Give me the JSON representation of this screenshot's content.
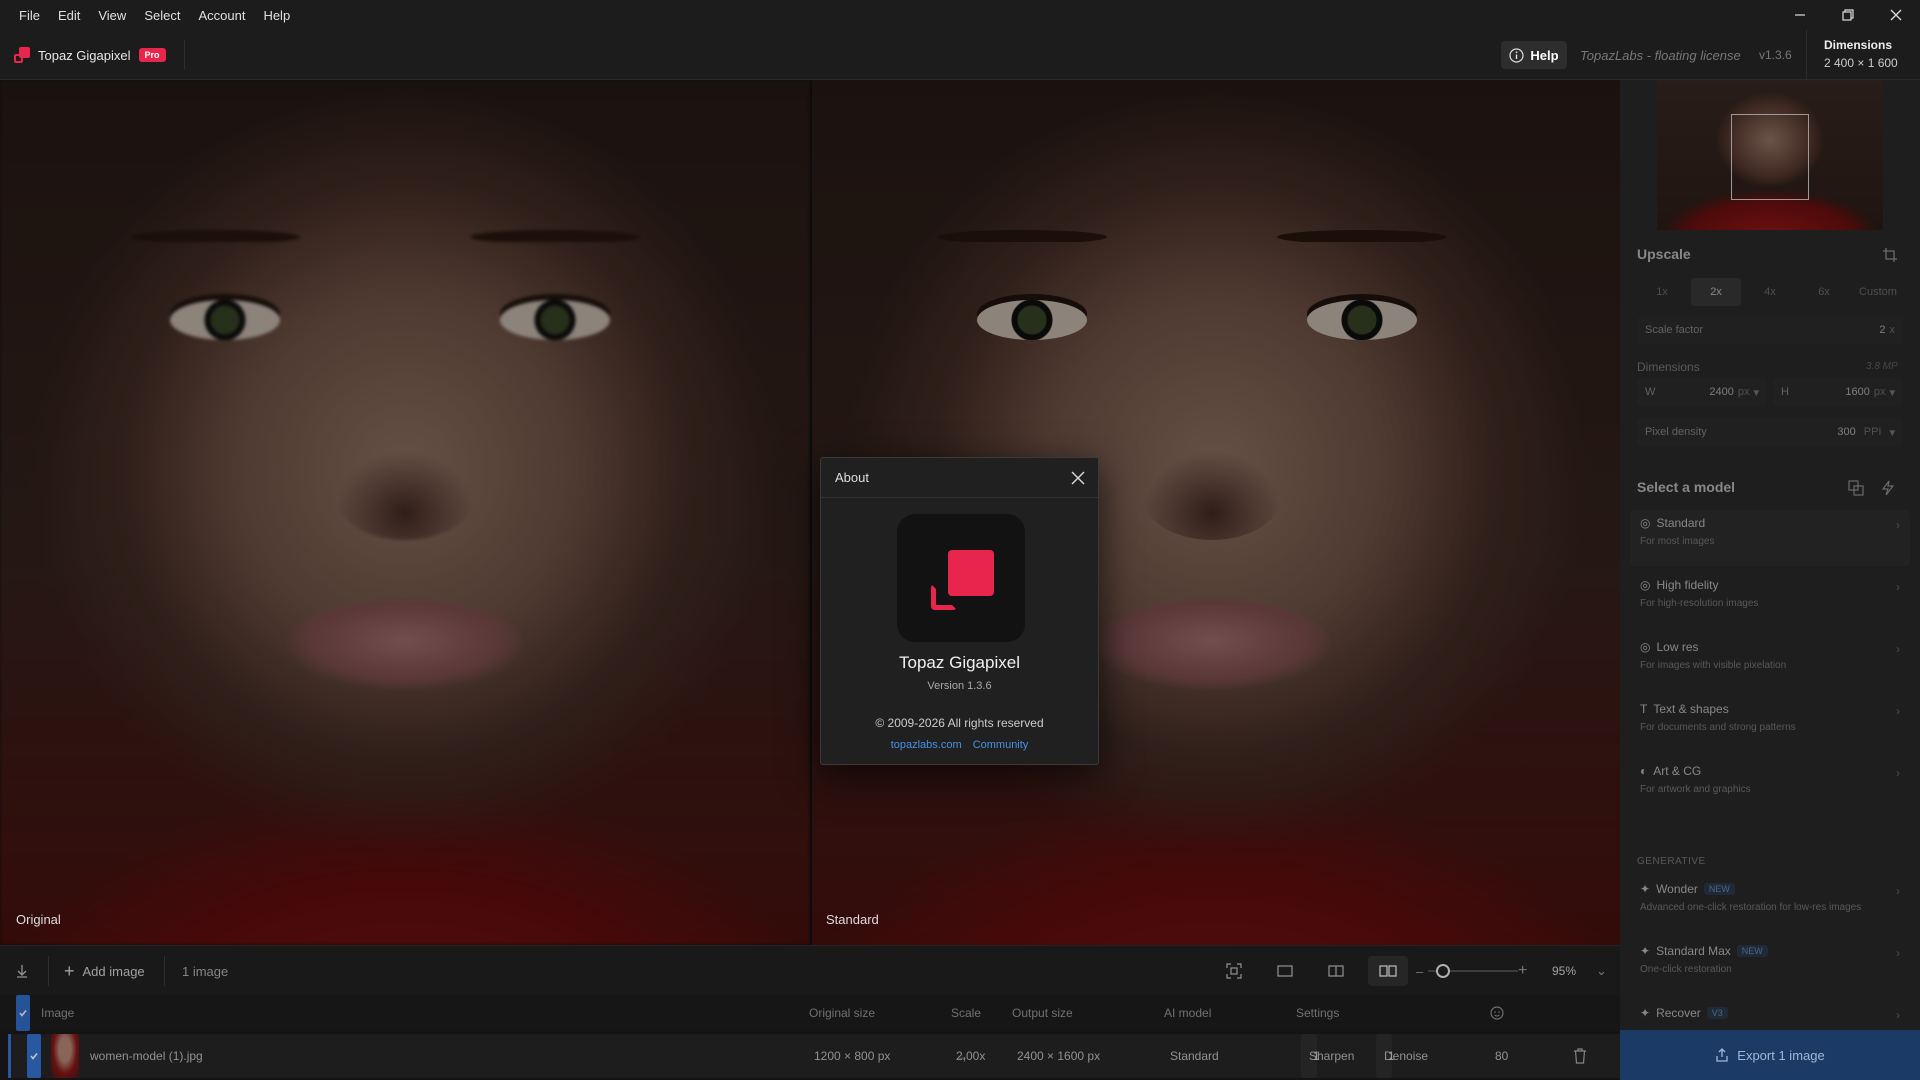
{
  "menu": [
    "File",
    "Edit",
    "View",
    "Select",
    "Account",
    "Help"
  ],
  "app": {
    "title": "Topaz Gigapixel",
    "badge": "Pro",
    "help_label": "Help",
    "license": "TopazLabs - floating license",
    "version": "v1.3.6",
    "dimensions_label": "Dimensions",
    "dimensions_value": "2 400 × 1 600"
  },
  "viewer": {
    "left_label": "Original",
    "right_label": "Standard"
  },
  "upscale": {
    "title": "Upscale",
    "tabs": [
      "1x",
      "2x",
      "4x",
      "6x",
      "Custom"
    ],
    "active_tab": "2x",
    "scale_factor_label": "Scale factor",
    "scale_factor_value": "2",
    "scale_factor_unit": "x",
    "dimensions_label": "Dimensions",
    "megapixels": "3.8 MP",
    "w_label": "W",
    "w_value": "2400",
    "h_label": "H",
    "h_value": "1600",
    "unit": "px",
    "density_label": "Pixel density",
    "density_value": "300",
    "density_unit": "PPI"
  },
  "models": {
    "title": "Select a model",
    "items": [
      {
        "name": "Standard",
        "desc": "For most images"
      },
      {
        "name": "High fidelity",
        "desc": "For high-resolution images"
      },
      {
        "name": "Low res",
        "desc": "For images with visible pixelation"
      },
      {
        "name": "Text & shapes",
        "desc": "For documents and strong patterns"
      },
      {
        "name": "Art & CG",
        "desc": "For artwork and graphics"
      }
    ],
    "generative_label": "GENERATIVE",
    "generative": [
      {
        "name": "Wonder",
        "badge": "NEW",
        "desc": "Advanced one-click restoration for low-res images"
      },
      {
        "name": "Standard Max",
        "badge": "NEW",
        "desc": "One-click restoration"
      },
      {
        "name": "Recover",
        "badge": "V3",
        "desc": ""
      }
    ]
  },
  "export_label": "Export 1 image",
  "toolbar": {
    "add_image": "Add image",
    "count": "1 image",
    "zoom": "95%"
  },
  "list": {
    "headers": {
      "image": "Image",
      "original_size": "Original size",
      "scale": "Scale",
      "output_size": "Output size",
      "ai_model": "AI model",
      "settings": "Settings"
    },
    "row": {
      "filename": "women-model (1).jpg",
      "original_size": "1200 × 800 px",
      "scale": "2,00x",
      "output_size": "2400 × 1600 px",
      "model": "Standard",
      "sharpen": "Sharpen",
      "sharpen_val": "1",
      "denoise": "Denoise",
      "denoise_val": "1",
      "face": "80"
    }
  },
  "about": {
    "title": "About",
    "app_name": "Topaz Gigapixel",
    "version": "Version 1.3.6",
    "copyright": "© 2009-2026 All rights reserved",
    "link1": "topazlabs.com",
    "link2": "Community"
  },
  "colors": {
    "brand": "#e8264d",
    "accent": "#2f6fd0"
  }
}
